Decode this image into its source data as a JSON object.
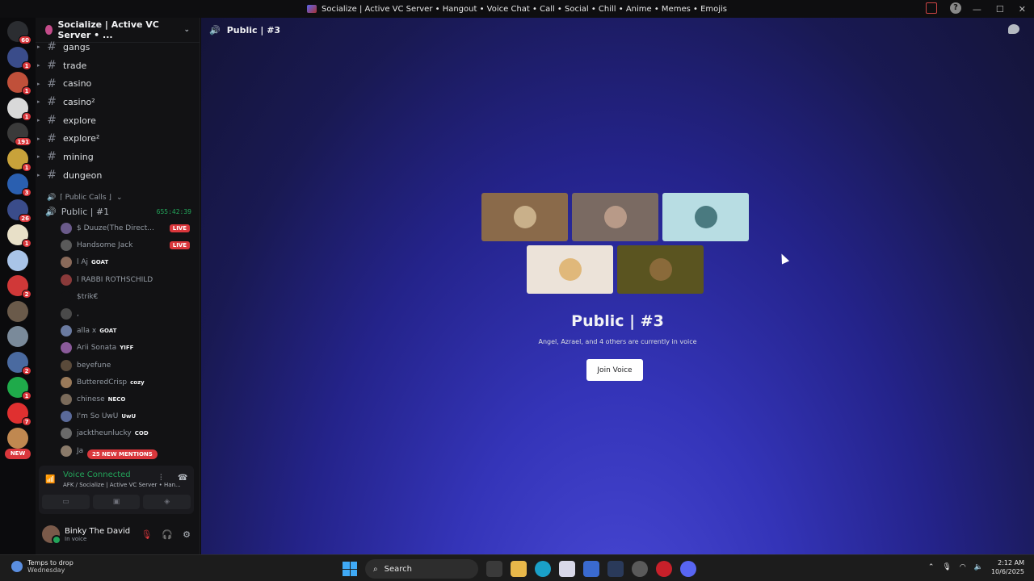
{
  "window": {
    "title": "Socialize | Active VC Server • Hangout • Voice Chat • Call • Social • Chill • Anime • Memes • Emojis"
  },
  "servers": [
    {
      "badge": "60",
      "color": "#2b2d31"
    },
    {
      "badge": "1",
      "color": "#3a4c8a"
    },
    {
      "badge": "1",
      "color": "#c0503a"
    },
    {
      "badge": "1",
      "color": "#d9d9d9"
    },
    {
      "badge": "191",
      "color": "#3a3a3a"
    },
    {
      "badge": "1",
      "color": "#c8a23a"
    },
    {
      "badge": "3",
      "color": "#2a5fb0"
    },
    {
      "badge": "26",
      "color": "#3a4c8a"
    },
    {
      "badge": "1",
      "color": "#e8e0c8"
    },
    {
      "badge": "",
      "color": "#a9c4e8"
    },
    {
      "badge": "2",
      "color": "#d03838"
    },
    {
      "badge": "",
      "color": "#6a5a4a"
    },
    {
      "badge": "",
      "color": "#7a8a9a"
    },
    {
      "badge": "2",
      "color": "#4a6aa0"
    },
    {
      "badge": "1",
      "color": "#1faa4a"
    },
    {
      "badge": "7",
      "color": "#e03030"
    },
    {
      "badge": "",
      "color": "#c08850"
    }
  ],
  "servers_new_label": "NEW",
  "guild": {
    "name": "Socialize | Active VC Server • ..."
  },
  "text_channels": [
    {
      "name": "gangs"
    },
    {
      "name": "trade"
    },
    {
      "name": "casino"
    },
    {
      "name": "casino²"
    },
    {
      "name": "explore"
    },
    {
      "name": "explore²"
    },
    {
      "name": "mining"
    },
    {
      "name": "dungeon"
    }
  ],
  "category": {
    "label": "⌈ Public Calls ⌋"
  },
  "voice_channel": {
    "name": "Public | #1",
    "timer": "655:42:39"
  },
  "members": [
    {
      "name": "$ Duuze(The Direct...",
      "tag": "",
      "status": "LIVE",
      "color": "#6a5a8a"
    },
    {
      "name": "Handsome Jack",
      "tag": "",
      "status": "LIVE",
      "color": "#5a5a5a"
    },
    {
      "name": "l Aj",
      "tag": "GOAT",
      "status": "",
      "color": "#8a6a5a"
    },
    {
      "name": "l RABBI ROTHSCHILD",
      "tag": "",
      "status": "",
      "color": "#8a3a3a"
    },
    {
      "name": "$trik€",
      "tag": "",
      "status": "",
      "color": "#121214"
    },
    {
      "name": ",",
      "tag": "",
      "status": "",
      "color": "#4a4a4a"
    },
    {
      "name": "alla x",
      "tag": "GOAT",
      "status": "",
      "color": "#6a7aa0"
    },
    {
      "name": "Arii Sonata",
      "tag": "YIFF",
      "status": "",
      "color": "#8a5a9a"
    },
    {
      "name": "beyefune",
      "tag": "",
      "status": "",
      "color": "#5a4a3a"
    },
    {
      "name": "ButteredCrisp",
      "tag": "cozy",
      "status": "",
      "color": "#9a7a5a"
    },
    {
      "name": "chinese",
      "tag": "NECO",
      "status": "",
      "color": "#7a6a5a"
    },
    {
      "name": "I'm So UwU",
      "tag": "UwU",
      "status": "",
      "color": "#5a6a9a"
    },
    {
      "name": "jacktheunlucky",
      "tag": "COD",
      "status": "",
      "color": "#6a6a6a"
    },
    {
      "name": "Ja",
      "tag": "",
      "status": "",
      "color": "#8a7a6a"
    }
  ],
  "mentions_label": "25 NEW MENTIONS",
  "voice_status": {
    "title": "Voice Connected",
    "subtitle": "AFK / Socialize | Active VC Server • Han..."
  },
  "user": {
    "name": "Binky The David",
    "status": "In voice"
  },
  "main": {
    "header": "Public | #3",
    "title": "Public | #3",
    "subtitle": "Angel, Azrael, and 4 others are currently in voice",
    "join_label": "Join Voice"
  },
  "tiles": [
    {
      "bg": "#8a6a4a",
      "avatar": "#c9b08a"
    },
    {
      "bg": "#7a6a62",
      "avatar": "#b89a88"
    },
    {
      "bg": "#b8dde3",
      "avatar": "#4a7a80"
    },
    {
      "bg": "#ece3d9",
      "avatar": "#e0b87a"
    },
    {
      "bg": "#5a5420",
      "avatar": "#8a6a3a"
    }
  ],
  "taskbar": {
    "weather_line1": "Temps to drop",
    "weather_line2": "Wednesday",
    "search_label": "Search",
    "time": "2:12 AM",
    "date": "10/6/2025"
  }
}
